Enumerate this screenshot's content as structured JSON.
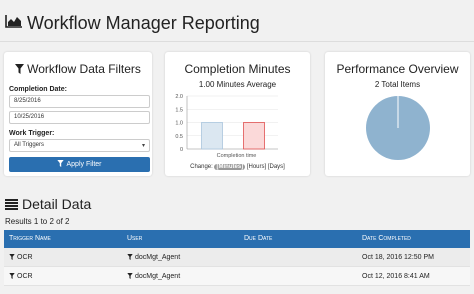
{
  "header": {
    "title": "Workflow Manager Reporting",
    "icon": "area-chart-icon"
  },
  "filters": {
    "title": "Workflow Data Filters",
    "completion_label": "Completion Date:",
    "date_from": "8/25/2016",
    "date_to": "10/25/2016",
    "trigger_label": "Work Trigger:",
    "trigger_value": "All Triggers",
    "apply_label": "Apply Filter"
  },
  "minutes": {
    "title": "Completion Minutes",
    "subtitle": "1.00 Minutes Average",
    "change_label": "Change:",
    "opt_minutes": "[Minutes]",
    "opt_hours": "[Hours]",
    "opt_days": "[Days]"
  },
  "performance": {
    "title": "Performance Overview",
    "subtitle": "2 Total Items"
  },
  "detail": {
    "title": "Detail Data",
    "results": "Results 1 to 2 of 2",
    "columns": [
      "Trigger Name",
      "User",
      "Due Date",
      "Date Completed"
    ],
    "rows": [
      {
        "trigger": "OCR",
        "user": "docMgt_Agent",
        "due": "",
        "completed": "Oct 18, 2016 12:50 PM"
      },
      {
        "trigger": "OCR",
        "user": "docMgt_Agent",
        "due": "",
        "completed": "Oct 12, 2016 8:41 AM"
      }
    ]
  },
  "colors": {
    "primary": "#2a6fb0",
    "bar_blue": "#aac6de",
    "bar_red": "#f4a3a3",
    "pie": "#8fb3cf"
  },
  "chart_data": [
    {
      "type": "bar",
      "xlabel": "Completion time",
      "ylim": [
        0,
        2.0
      ],
      "yticks": [
        "2.0",
        "1.5",
        "1.0",
        "0.5",
        "0"
      ],
      "categories": [
        "",
        ""
      ],
      "values": [
        1,
        1
      ]
    },
    {
      "type": "pie",
      "values": [
        2
      ],
      "labels": [
        ""
      ]
    }
  ]
}
